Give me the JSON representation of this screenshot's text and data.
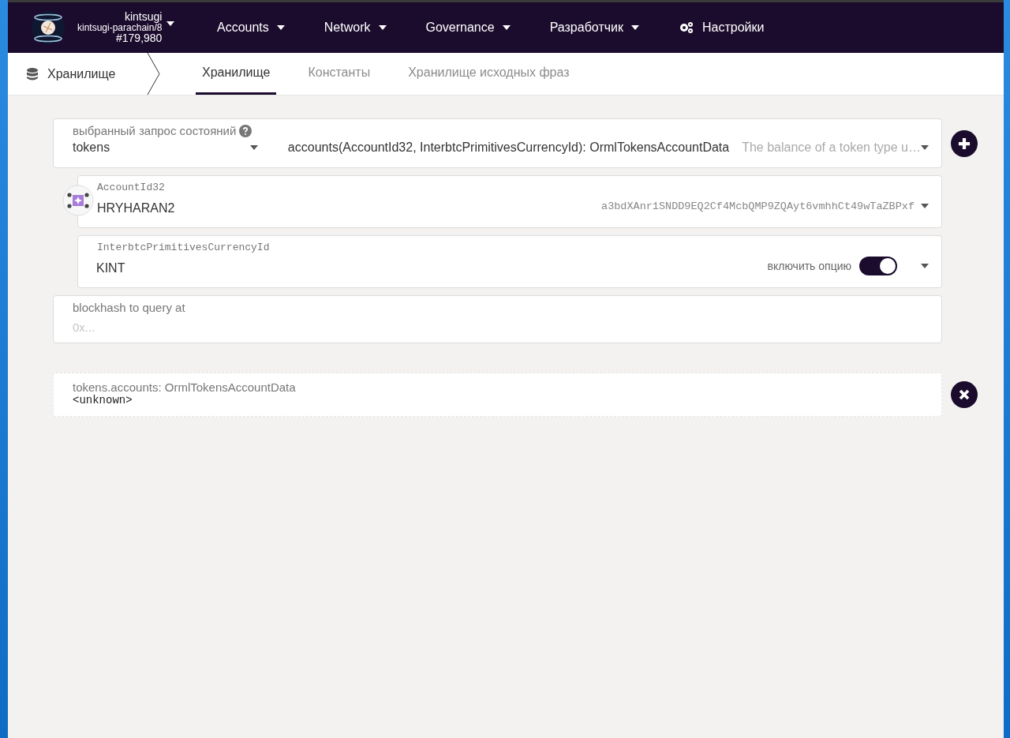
{
  "header": {
    "chain_name": "kintsugi",
    "network": "kintsugi-parachain/8",
    "block": "#179,980"
  },
  "nav": [
    {
      "label": "Accounts",
      "kind": "menu"
    },
    {
      "label": "Network",
      "kind": "menu"
    },
    {
      "label": "Governance",
      "kind": "menu"
    },
    {
      "label": "Разработчик",
      "kind": "menu"
    },
    {
      "label": "Настройки",
      "kind": "settings"
    }
  ],
  "subnav": {
    "section": "Хранилище",
    "tabs": [
      {
        "label": "Хранилище",
        "selected": true
      },
      {
        "label": "Константы",
        "selected": false
      },
      {
        "label": "Хранилище исходных фраз",
        "selected": false
      }
    ]
  },
  "query": {
    "label": "выбранный запрос состояний",
    "module": "tokens",
    "method": "accounts(AccountId32, InterbtcPrimitivesCurrencyId): OrmlTokensAccountData",
    "description": "The balance of a token type u…"
  },
  "params": [
    {
      "kind": "account",
      "label": "AccountId32",
      "value": "HRYHARAN2",
      "address": "a3bdXAnr1SNDD9EQ2Cf4McbQMP9ZQAyt6vmhhCt49wTaZBPxf"
    },
    {
      "kind": "option",
      "label": "InterbtcPrimitivesCurrencyId",
      "value": "KINT",
      "toggle_label": "включить опцию",
      "on": true
    }
  ],
  "blockhash": {
    "label": "blockhash to query at",
    "placeholder": "0x..."
  },
  "result": {
    "title": "tokens.accounts: OrmlTokensAccountData",
    "value": "<unknown>"
  }
}
